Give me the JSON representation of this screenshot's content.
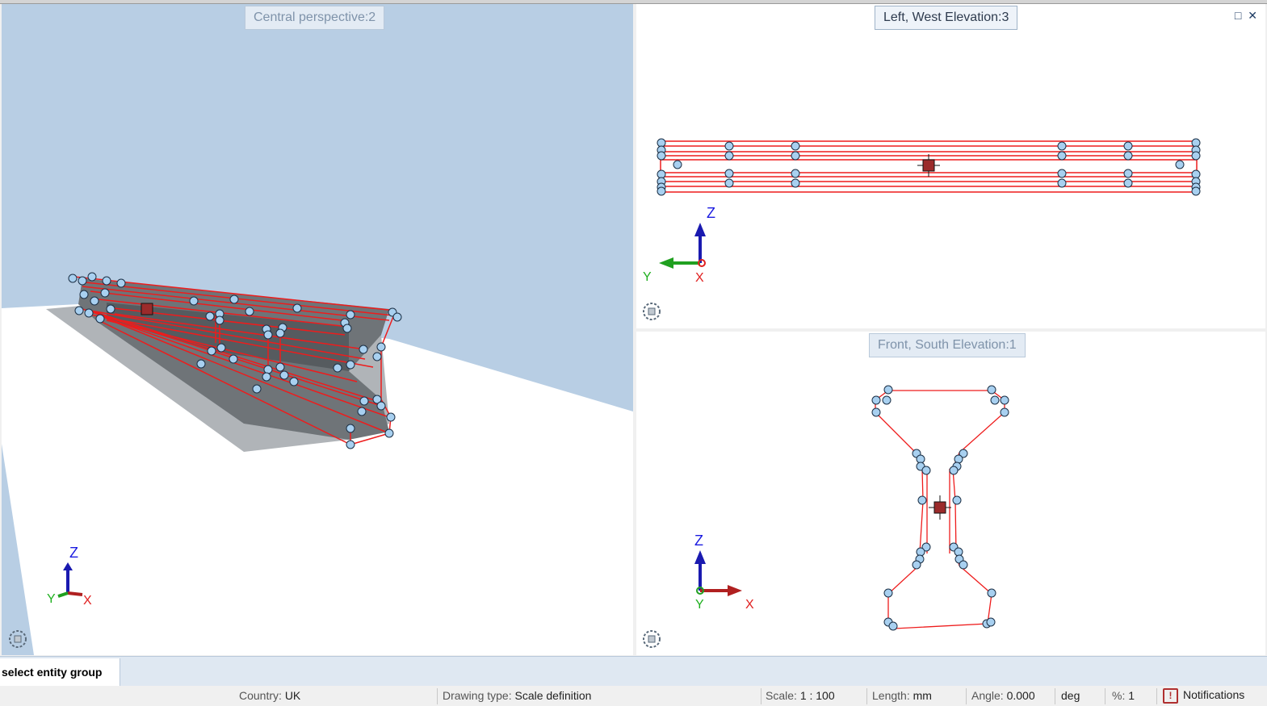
{
  "viewports": {
    "perspective": {
      "title": "Central perspective:2"
    },
    "left": {
      "title": "Left, West Elevation:3"
    },
    "front": {
      "title": "Front, South Elevation:1"
    }
  },
  "axes": {
    "x": "X",
    "y": "Y",
    "z": "Z"
  },
  "window_controls": {
    "restore": "□",
    "close": "✕"
  },
  "command": {
    "prompt": "select entity group"
  },
  "status": {
    "country_label": "Country:",
    "country_value": "UK",
    "drawing_type_label": "Drawing type:",
    "drawing_type_value": "Scale definition",
    "scale_label": "Scale:",
    "scale_value": "1 : 100",
    "length_label": "Length:",
    "length_value": "mm",
    "angle_label": "Angle:",
    "angle_value": "0.000",
    "angle_unit": "deg",
    "percent_label": "%:",
    "percent_value": "1",
    "notifications_label": "Notifications"
  },
  "colors": {
    "sky": "#b8cee4",
    "ground": "#ffffff",
    "wire": "#ee1c1c",
    "handle": "#a8d0f0",
    "beam_face": "#6f7478",
    "shadow": "#b0b4b8"
  }
}
